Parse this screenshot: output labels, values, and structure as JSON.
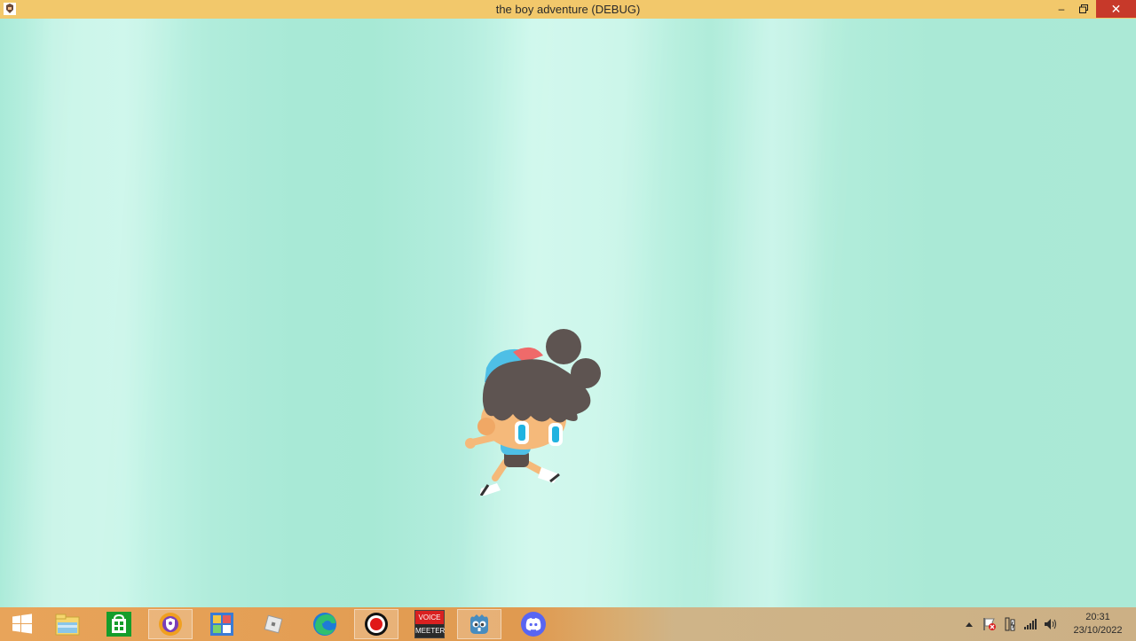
{
  "window": {
    "title": "the boy adventure (DEBUG)",
    "controls": {
      "minimize": "–",
      "maximize": "🗗",
      "close": "✕"
    },
    "accent": "#f2c86b"
  },
  "game": {
    "background": "#ade9d5",
    "character": "boy-running"
  },
  "taskbar": {
    "start_icon": "windows-logo-icon",
    "apps": [
      {
        "name": "file-explorer-icon"
      },
      {
        "name": "store-icon"
      },
      {
        "name": "browser-shield-icon",
        "active": true
      },
      {
        "name": "photo-app-icon"
      },
      {
        "name": "roblox-icon"
      },
      {
        "name": "edge-icon"
      },
      {
        "name": "record-icon"
      },
      {
        "name": "voicemeeter-icon",
        "label_top": "VOICE",
        "label_bottom": "MEETER"
      },
      {
        "name": "godot-icon",
        "active": true
      },
      {
        "name": "discord-icon"
      }
    ],
    "tray": {
      "icons": [
        "show-hidden-icons-chevron",
        "action-center-flag-icon",
        "power-icon",
        "network-signal-icon",
        "volume-icon"
      ],
      "time": "20:31",
      "date": "23/10/2022"
    }
  }
}
